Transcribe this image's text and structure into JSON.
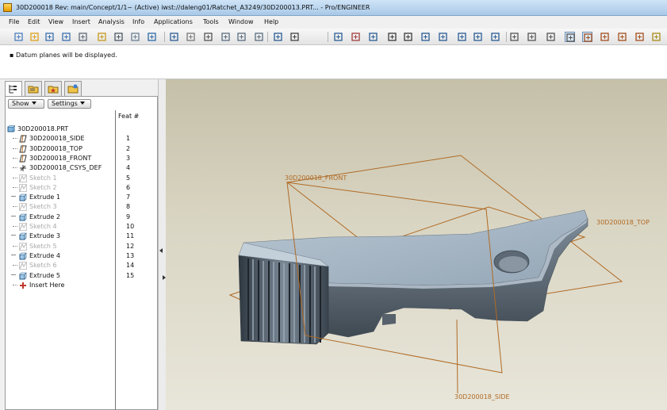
{
  "window": {
    "title": "30D200018 Rev: main/Concept/1/1~ (Active) iwst://daleng01/Ratchet_A3249/30D200013.PRT... - Pro/ENGINEER"
  },
  "menu": [
    "File",
    "Edit",
    "View",
    "Insert",
    "Analysis",
    "Info",
    "Applications",
    "Tools",
    "Window",
    "Help"
  ],
  "toolbar": {
    "icons": [
      "new-icon",
      "open-icon",
      "save-icon",
      "save-copy-icon",
      "erase-icon",
      "regenerate-icon",
      "print-icon",
      "email-icon",
      "send-icon",
      "undo-icon",
      "redo-icon",
      "cut-icon",
      "copy-icon",
      "paste-icon",
      "paste-special-icon",
      "model-tree-icon",
      "layers-icon",
      "select-box-icon",
      "spin-center-icon",
      "named-views-icon",
      "zoom-in-icon",
      "zoom-out-icon",
      "refit-icon",
      "reorient-icon",
      "saved-views-icon",
      "layers-view-icon",
      "display-style-icon",
      "wireframe-icon",
      "hidden-line-icon",
      "no-hidden-icon",
      "shading-icon",
      "datum-planes-icon",
      "datum-axes-icon",
      "datum-points-icon",
      "csys-icon",
      "annotations-icon"
    ]
  },
  "message": {
    "text": "Datum planes will be displayed."
  },
  "navigator": {
    "tabs": [
      "model-tree-tab-icon",
      "folder-browser-tab-icon",
      "favorites-tab-icon",
      "connections-tab-icon"
    ],
    "show_button": "Show",
    "settings_button": "Settings",
    "feat_column_header": "Feat #",
    "items": [
      {
        "label": "30D200018.PRT",
        "feat": "",
        "icon": "part-icon",
        "dim": false,
        "indent": 0
      },
      {
        "label": "30D200018_SIDE",
        "feat": "1",
        "icon": "datum-plane-icon",
        "dim": false,
        "indent": 1
      },
      {
        "label": "30D200018_TOP",
        "feat": "2",
        "icon": "datum-plane-icon",
        "dim": false,
        "indent": 1
      },
      {
        "label": "30D200018_FRONT",
        "feat": "3",
        "icon": "datum-plane-icon",
        "dim": false,
        "indent": 1
      },
      {
        "label": "30D200018_CSYS_DEF",
        "feat": "4",
        "icon": "csys-icon",
        "dim": false,
        "indent": 1
      },
      {
        "label": "Sketch 1",
        "feat": "5",
        "icon": "sketch-icon",
        "dim": true,
        "indent": 1
      },
      {
        "label": "Sketch 2",
        "feat": "6",
        "icon": "sketch-icon",
        "dim": true,
        "indent": 1
      },
      {
        "label": "Extrude 1",
        "feat": "7",
        "icon": "extrude-icon",
        "dim": false,
        "indent": 1
      },
      {
        "label": "Sketch 3",
        "feat": "8",
        "icon": "sketch-icon",
        "dim": true,
        "indent": 1
      },
      {
        "label": "Extrude 2",
        "feat": "9",
        "icon": "extrude-icon",
        "dim": false,
        "indent": 1
      },
      {
        "label": "Sketch 4",
        "feat": "10",
        "icon": "sketch-icon",
        "dim": true,
        "indent": 1
      },
      {
        "label": "Extrude 3",
        "feat": "11",
        "icon": "extrude-icon",
        "dim": false,
        "indent": 1
      },
      {
        "label": "Sketch 5",
        "feat": "12",
        "icon": "sketch-icon",
        "dim": true,
        "indent": 1
      },
      {
        "label": "Extrude 4",
        "feat": "13",
        "icon": "extrude-icon",
        "dim": false,
        "indent": 1
      },
      {
        "label": "Sketch 6",
        "feat": "14",
        "icon": "sketch-icon",
        "dim": true,
        "indent": 1
      },
      {
        "label": "Extrude 5",
        "feat": "15",
        "icon": "extrude-icon",
        "dim": false,
        "indent": 1
      },
      {
        "label": "Insert Here",
        "feat": "",
        "icon": "insert-here-icon",
        "dim": false,
        "indent": 1
      }
    ]
  },
  "viewport": {
    "datum_labels": {
      "front": "30D200018_FRONT",
      "top": "30D200018_TOP",
      "side": "30D200018_SIDE"
    },
    "colors": {
      "datum": "#b06a25",
      "model_light": "#a7b8c6",
      "model_dark": "#4d5862"
    }
  }
}
